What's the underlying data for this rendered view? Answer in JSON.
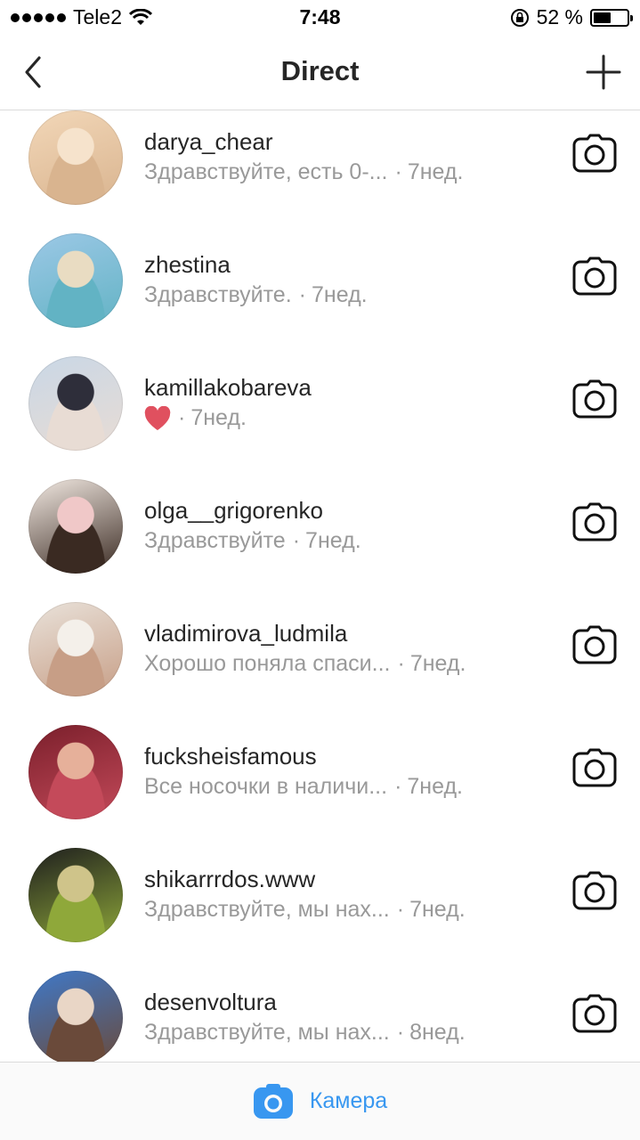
{
  "status_bar": {
    "carrier": "Tele2",
    "time": "7:48",
    "battery_percent": "52 %",
    "battery_level": 0.52,
    "signal_icon": "signal-dots-icon",
    "wifi_icon": "wifi-icon",
    "rotation_lock_icon": "rotation-lock-icon"
  },
  "nav": {
    "title": "Direct",
    "back_icon": "chevron-left-icon",
    "new_icon": "plus-icon"
  },
  "threads": [
    {
      "username": "darya_chear",
      "message": "Здравствуйте, есть 0-...",
      "time": "7нед.",
      "avatar_colors": [
        "#f2d7b8",
        "#d9b48f",
        "#f6e3cc"
      ]
    },
    {
      "username": "zhestina",
      "message": "Здравствуйте.",
      "time": "7нед.",
      "avatar_colors": [
        "#9cc8e6",
        "#62b3c4",
        "#e9dcc2"
      ]
    },
    {
      "username": "kamillakobareva",
      "message": "",
      "heart": true,
      "time": "7нед.",
      "avatar_colors": [
        "#c9d7e6",
        "#e8dcd4",
        "#2e2e3a"
      ]
    },
    {
      "username": "olga__grigorenko",
      "message": "Здравствуйте",
      "time": "7нед.",
      "avatar_colors": [
        "#f2e9e2",
        "#3a2a22",
        "#f0c8c8"
      ]
    },
    {
      "username": "vladimirova_ludmila",
      "message": "Хорошо поняла спаси...",
      "time": "7нед.",
      "avatar_colors": [
        "#e9e2da",
        "#c79e86",
        "#f4f0ea"
      ]
    },
    {
      "username": "fucksheisfamous",
      "message": "Все носочки в наличи...",
      "time": "7нед.",
      "avatar_colors": [
        "#7a1f2b",
        "#c44a5a",
        "#e6b09a"
      ]
    },
    {
      "username": "shikarrrdos.www",
      "message": "Здравствуйте, мы нах...",
      "time": "7нед.",
      "avatar_colors": [
        "#1e1e1e",
        "#8fa83a",
        "#cfc48a"
      ]
    },
    {
      "username": "desenvoltura",
      "message": "Здравствуйте, мы нах...",
      "time": "8нед.",
      "avatar_colors": [
        "#3f79c9",
        "#6a4a3a",
        "#e9d6c6"
      ]
    }
  ],
  "bottom_bar": {
    "label": "Камера",
    "icon": "camera-icon",
    "accent": "#3897f0"
  }
}
